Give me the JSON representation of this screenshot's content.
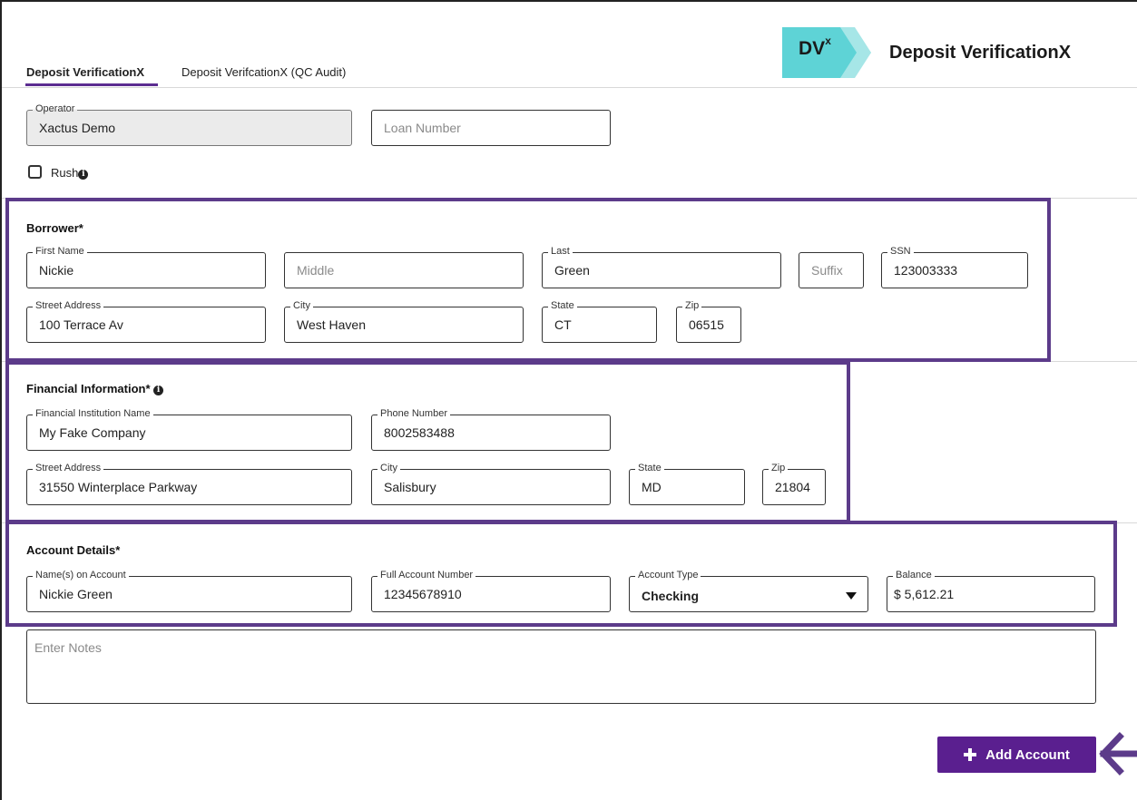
{
  "tabs": [
    {
      "label": "Deposit VerificationX",
      "active": true
    },
    {
      "label": "Deposit VerifcationX (QC Audit)",
      "active": false
    }
  ],
  "logo": {
    "badge": "DV",
    "badge_sup": "x",
    "title": "Deposit VerificationX",
    "badge_color": "#5ed3d6"
  },
  "top": {
    "operator": {
      "label": "Operator",
      "value": "Xactus Demo"
    },
    "loan_number": {
      "placeholder": "Loan Number"
    },
    "rush": {
      "label": "Rush",
      "checked": false
    }
  },
  "borrower": {
    "title": "Borrower*",
    "first_name": {
      "label": "First Name",
      "value": "Nickie"
    },
    "middle": {
      "placeholder": "Middle"
    },
    "last": {
      "label": "Last",
      "value": "Green"
    },
    "suffix": {
      "placeholder": "Suffix"
    },
    "ssn": {
      "label": "SSN",
      "value": "123003333"
    },
    "street": {
      "label": "Street Address",
      "value": "100 Terrace Av"
    },
    "city": {
      "label": "City",
      "value": "West Haven"
    },
    "state": {
      "label": "State",
      "value": "CT"
    },
    "zip": {
      "label": "Zip",
      "value": "06515"
    }
  },
  "financial": {
    "title": "Financial Information*",
    "institution": {
      "label": "Financial Institution Name",
      "value": "My Fake Company"
    },
    "phone": {
      "label": "Phone Number",
      "value": "8002583488"
    },
    "street": {
      "label": "Street Address",
      "value": "31550 Winterplace Parkway"
    },
    "city": {
      "label": "City",
      "value": "Salisbury"
    },
    "state": {
      "label": "State",
      "value": "MD"
    },
    "zip": {
      "label": "Zip",
      "value": "21804"
    }
  },
  "account": {
    "title": "Account Details*",
    "names": {
      "label": "Name(s) on Account",
      "value": "Nickie Green"
    },
    "number": {
      "label": "Full Account Number",
      "value": "12345678910"
    },
    "type": {
      "label": "Account Type",
      "value": "Checking"
    },
    "balance": {
      "label": "Balance",
      "value": "$ 5,612.21"
    }
  },
  "notes": {
    "placeholder": "Enter Notes"
  },
  "add_account": {
    "label": "Add Account"
  },
  "colors": {
    "accent": "#5a1f8f",
    "highlight": "#5c3b8a"
  }
}
